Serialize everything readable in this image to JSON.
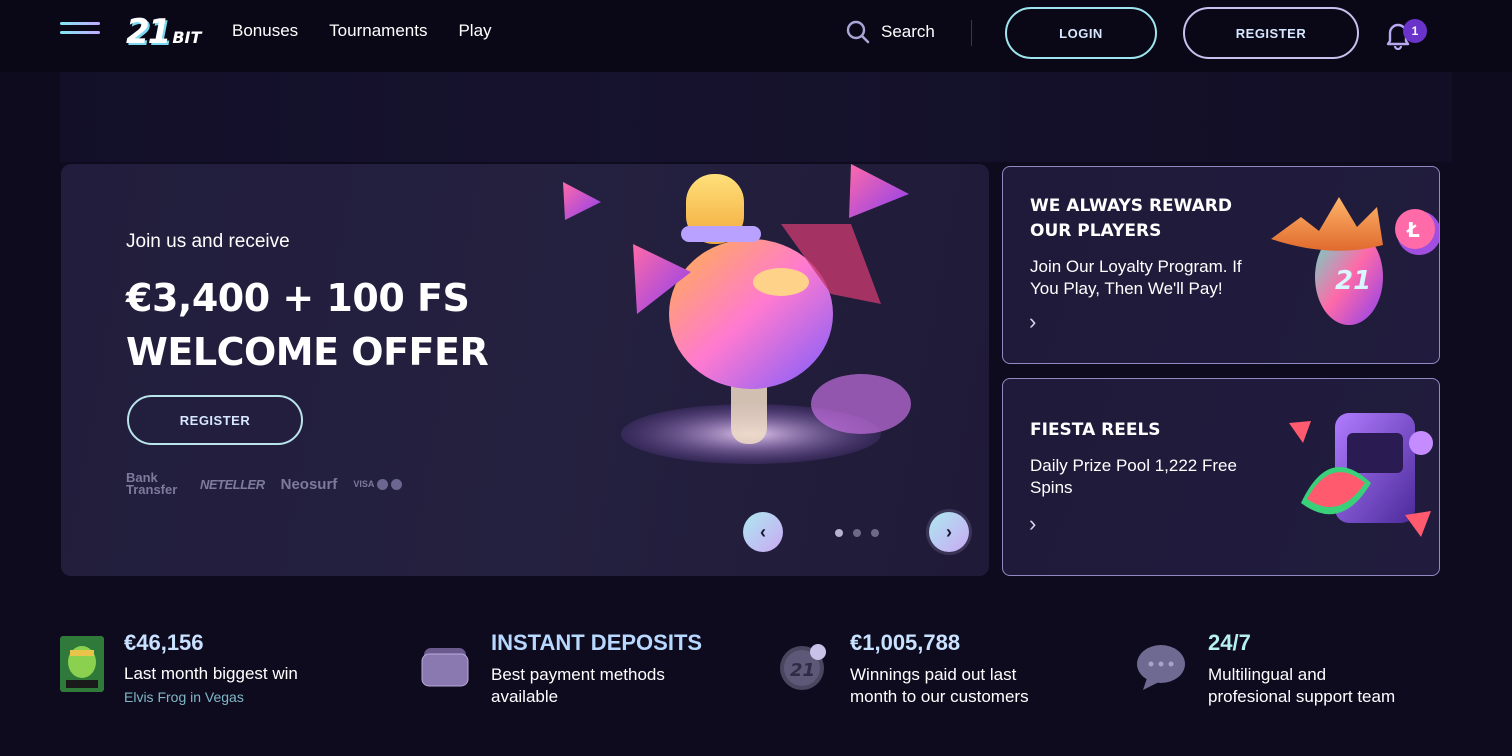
{
  "header": {
    "logo_main": "21",
    "logo_small": "BIT",
    "nav": [
      "Bonuses",
      "Tournaments",
      "Play"
    ],
    "search_label": "Search",
    "login_label": "LOGIN",
    "register_label": "REGISTER",
    "notification_count": "1"
  },
  "hero": {
    "subtitle": "Join us and receive",
    "title_line1": "€3,400 + 100 FS",
    "title_line2": "WELCOME OFFER",
    "register_label": "REGISTER",
    "payments": {
      "bank": "Bank Transfer",
      "neteller": "NETELLER",
      "neosurf": "Neosurf",
      "visa": "VISA"
    },
    "carousel": {
      "slides": 3,
      "active": 0,
      "prev_icon": "chevron-left-icon",
      "next_icon": "chevron-right-icon"
    }
  },
  "cards": [
    {
      "title_line1": "WE ALWAYS REWARD",
      "title_line2": "OUR PLAYERS",
      "text_line1": "Join Our Loyalty Program. If",
      "text_line2": "You Play, Then We'll Pay!",
      "arrow": "›"
    },
    {
      "title_line1": "FIESTA REELS",
      "text_line1": "Daily Prize Pool 1,222 Free",
      "text_line2": "Spins",
      "arrow": "›"
    }
  ],
  "stats": [
    {
      "value": "€46,156",
      "line1": "Last month biggest win",
      "link": "Elvis Frog in Vegas",
      "icon": "game-thumbnail"
    },
    {
      "value": "INSTANT DEPOSITS",
      "line1": "Best payment methods",
      "line2": "available",
      "icon": "wallet-icon"
    },
    {
      "value": "€1,005,788",
      "line1": "Winnings paid out last",
      "line2": "month to our customers",
      "icon": "coin-icon"
    },
    {
      "value": "24/7",
      "line1": "Multilingual and",
      "line2": "profesional support team",
      "icon": "chat-icon"
    }
  ],
  "colors": {
    "background": "#0e0b1f",
    "header": "#0a0817",
    "accent_cyan": "#9ee6ef",
    "accent_purple": "#c9a9f3",
    "badge": "#6a33c9"
  }
}
